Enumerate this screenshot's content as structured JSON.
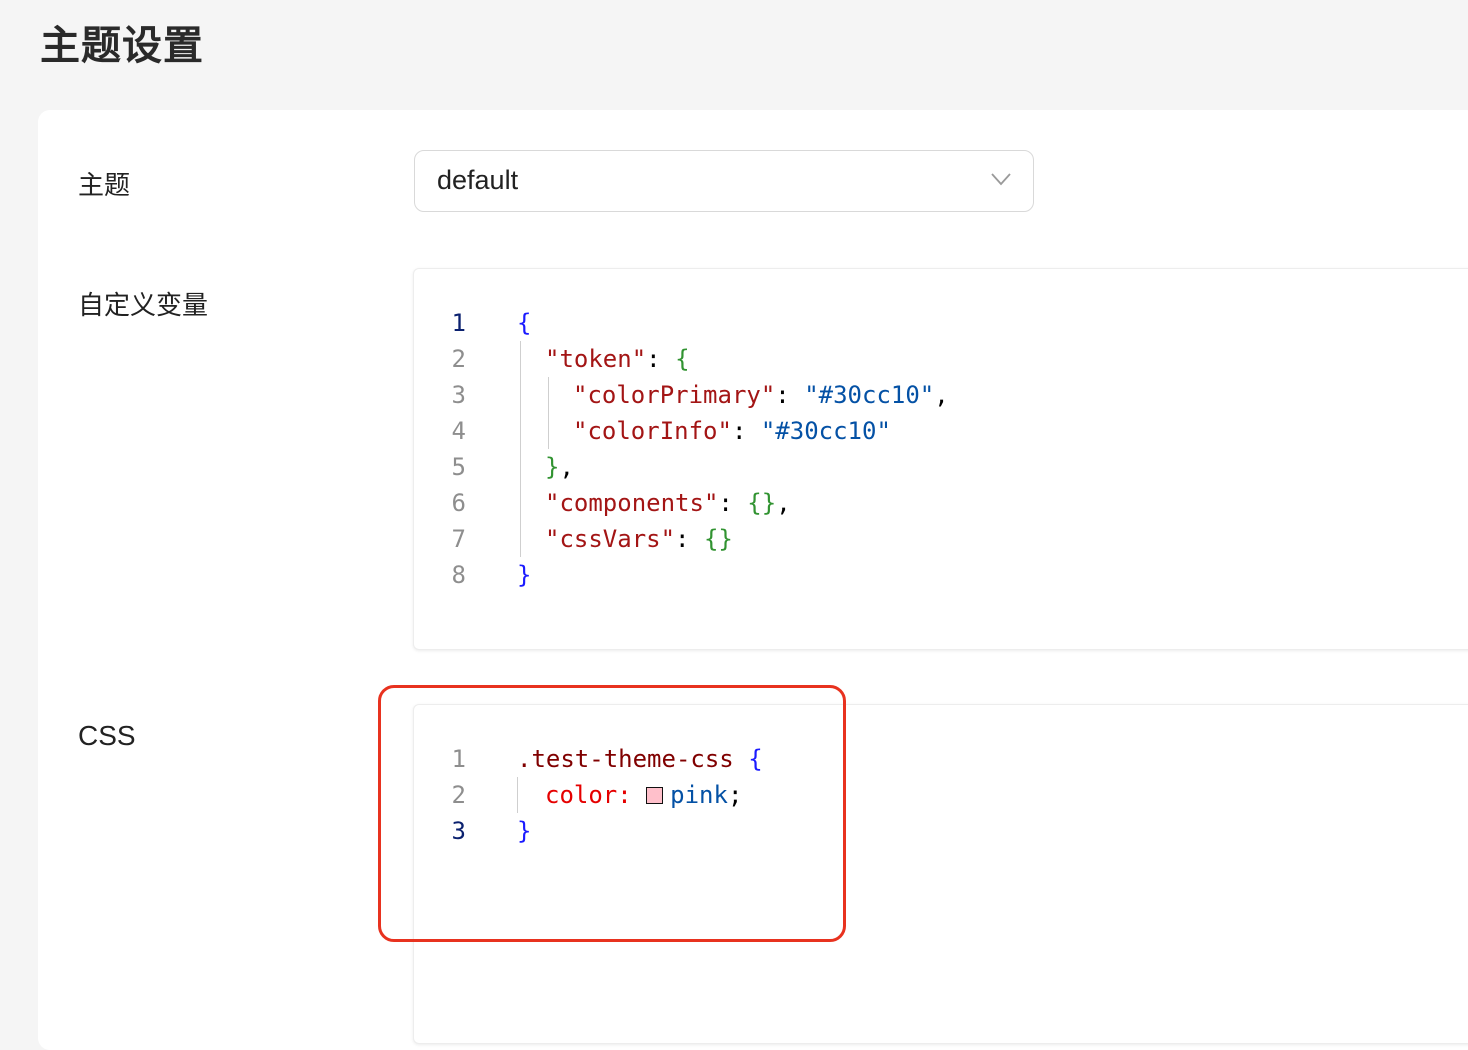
{
  "page": {
    "title": "主题设置"
  },
  "form": {
    "theme_label": "主题",
    "theme_value": "default",
    "custom_vars_label": "自定义变量",
    "css_label": "CSS"
  },
  "json_editor": {
    "lines": [
      {
        "num": "1",
        "tokens": [
          {
            "t": "{",
            "c": "tk-brace"
          }
        ]
      },
      {
        "num": "2",
        "tokens": [
          {
            "t": "\"token\"",
            "c": "tk-key"
          },
          {
            "t": ": ",
            "c": "tk-punc"
          },
          {
            "t": "{",
            "c": "tk-brace-g"
          }
        ]
      },
      {
        "num": "3",
        "tokens": [
          {
            "t": "\"colorPrimary\"",
            "c": "tk-key"
          },
          {
            "t": ": ",
            "c": "tk-punc"
          },
          {
            "t": "\"#30cc10\"",
            "c": "tk-str"
          },
          {
            "t": ",",
            "c": "tk-punc"
          }
        ]
      },
      {
        "num": "4",
        "tokens": [
          {
            "t": "\"colorInfo\"",
            "c": "tk-key"
          },
          {
            "t": ": ",
            "c": "tk-punc"
          },
          {
            "t": "\"#30cc10\"",
            "c": "tk-str"
          }
        ]
      },
      {
        "num": "5",
        "tokens": [
          {
            "t": "}",
            "c": "tk-brace-g"
          },
          {
            "t": ",",
            "c": "tk-punc"
          }
        ]
      },
      {
        "num": "6",
        "tokens": [
          {
            "t": "\"components\"",
            "c": "tk-key"
          },
          {
            "t": ": ",
            "c": "tk-punc"
          },
          {
            "t": "{}",
            "c": "tk-brace-g"
          },
          {
            "t": ",",
            "c": "tk-punc"
          }
        ]
      },
      {
        "num": "7",
        "tokens": [
          {
            "t": "\"cssVars\"",
            "c": "tk-key"
          },
          {
            "t": ": ",
            "c": "tk-punc"
          },
          {
            "t": "{}",
            "c": "tk-brace-g"
          }
        ]
      },
      {
        "num": "8",
        "tokens": [
          {
            "t": "}",
            "c": "tk-brace"
          }
        ]
      }
    ]
  },
  "css_editor": {
    "lines": [
      {
        "num": "1",
        "tokens": [
          {
            "t": ".test-theme-css",
            "c": "tk-sel"
          },
          {
            "t": " ",
            "c": "tk-punc"
          },
          {
            "t": "{",
            "c": "tk-brace"
          }
        ]
      },
      {
        "num": "2",
        "tokens": [
          {
            "t": "color",
            "c": "tk-prop"
          },
          {
            "t": ": ",
            "c": "tk-prop"
          },
          {
            "t": "pink",
            "c": "tk-val",
            "swatch": "#ffc0cb"
          },
          {
            "t": ";",
            "c": "tk-punc"
          }
        ]
      },
      {
        "num": "3",
        "tokens": [
          {
            "t": "}",
            "c": "tk-brace"
          }
        ]
      }
    ]
  },
  "colors": {
    "highlight_border": "#e8321f",
    "pink_swatch": "#ffc0cb"
  }
}
